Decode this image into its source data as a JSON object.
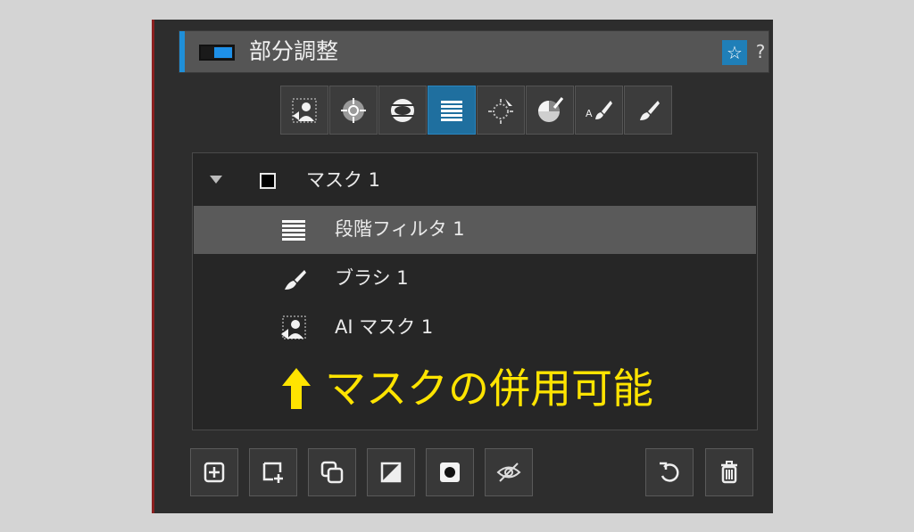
{
  "panel": {
    "title": "部分調整",
    "favorite_icon": "star-icon",
    "help_label": "?",
    "accent_color": "#1f8fd8"
  },
  "toolbar": {
    "tools": [
      {
        "icon": "ai-mask-icon"
      },
      {
        "icon": "control-point-icon"
      },
      {
        "icon": "radial-filter-icon"
      },
      {
        "icon": "gradient-filter-icon",
        "active": true
      },
      {
        "icon": "selection-control-point-icon"
      },
      {
        "icon": "color-range-icon"
      },
      {
        "icon": "auto-brush-icon",
        "text": "A"
      },
      {
        "icon": "brush-icon"
      }
    ]
  },
  "mask_list": {
    "group": {
      "label": "マスク 1"
    },
    "items": [
      {
        "label": "段階フィルタ 1",
        "icon": "gradient-filter-icon",
        "selected": true
      },
      {
        "label": "ブラシ 1",
        "icon": "brush-icon"
      },
      {
        "label": "AI マスク 1",
        "icon": "ai-mask-icon"
      }
    ]
  },
  "annotation": {
    "text": "マスクの併用可能",
    "color": "#ffe400",
    "icon": "arrow-up-icon"
  },
  "bottom_toolbar": {
    "buttons": [
      {
        "icon": "add-mask-icon"
      },
      {
        "icon": "add-to-mask-icon"
      },
      {
        "icon": "duplicate-icon"
      },
      {
        "icon": "invert-icon"
      },
      {
        "icon": "show-mask-overlay-icon"
      },
      {
        "icon": "hide-mask-icon"
      },
      {
        "icon": "reset-icon"
      },
      {
        "icon": "delete-icon"
      }
    ]
  }
}
